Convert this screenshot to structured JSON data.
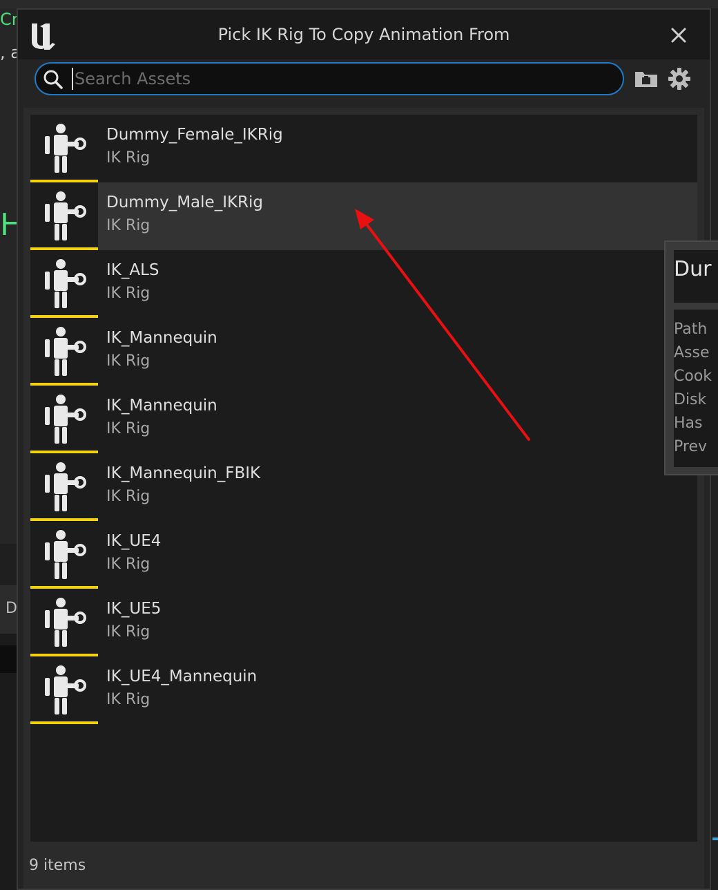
{
  "background": {
    "frag_cr": "Cr",
    "frag_comma": ", a",
    "frag_h": "H",
    "frag_d": "D"
  },
  "dialog": {
    "title": "Pick IK Rig To Copy Animation From",
    "search_placeholder": "Search Assets"
  },
  "items": [
    {
      "name": "Dummy_Female_IKRig",
      "type": "IK Rig"
    },
    {
      "name": "Dummy_Male_IKRig",
      "type": "IK Rig"
    },
    {
      "name": "IK_ALS",
      "type": "IK Rig"
    },
    {
      "name": "IK_Mannequin",
      "type": "IK Rig"
    },
    {
      "name": "IK_Mannequin",
      "type": "IK Rig"
    },
    {
      "name": "IK_Mannequin_FBIK",
      "type": "IK Rig"
    },
    {
      "name": "IK_UE4",
      "type": "IK Rig"
    },
    {
      "name": "IK_UE5",
      "type": "IK Rig"
    },
    {
      "name": "IK_UE4_Mannequin",
      "type": "IK Rig"
    }
  ],
  "status": "9 items",
  "tooltip": {
    "title": "Dur",
    "rows": [
      "Path",
      "Asse",
      "Cook",
      "Disk",
      "Has",
      "Prev"
    ]
  },
  "colors": {
    "accent": "#1f79c6",
    "asset_bar": "#f2d313",
    "annotation": "#e81010"
  }
}
